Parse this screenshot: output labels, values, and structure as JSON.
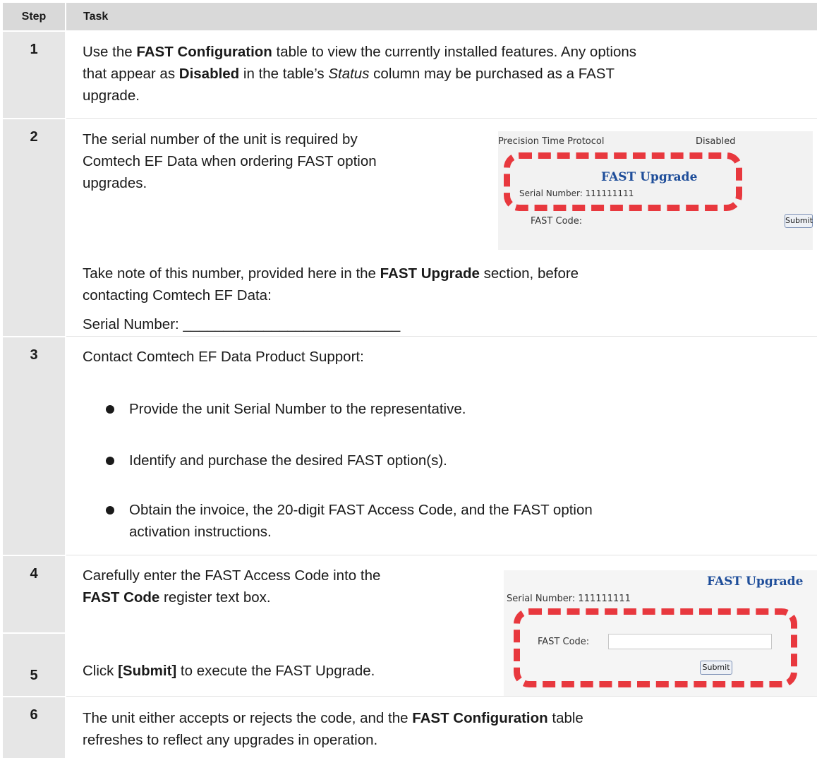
{
  "header": {
    "step": "Step",
    "task": "Task"
  },
  "rows": {
    "r1": {
      "step": "1",
      "line1_pre": "Use the ",
      "line1_bold": "FAST Configuration",
      "line1_post": " table to view the currently installed features. Any options",
      "line2_pre": "that appear as ",
      "line2_bold": "Disabled",
      "line2_mid": " in the table’s ",
      "line2_ital": "Status",
      "line2_post": " column may be purchased as a FAST",
      "line3": "upgrade."
    },
    "r2": {
      "step": "2",
      "line1": "The serial number of the unit is required by",
      "line2": "Comtech EF Data when ordering FAST option",
      "line3": "upgrades.",
      "note1_pre": "Take note of this number, provided here in the ",
      "note1_bold": "FAST Upgrade",
      "note1_post": " section, before",
      "note2": "contacting Comtech EF Data:",
      "serial_line": "Serial Number: ___________________________"
    },
    "r3": {
      "step": "3",
      "intro": "Contact Comtech EF Data Product Support:",
      "bullets": [
        "Provide the unit Serial Number to the representative.",
        "Identify and purchase the desired FAST option(s).",
        "Obtain the invoice, the 20-digit FAST Access Code, and the FAST option"
      ],
      "bullet3_cont": "activation instructions."
    },
    "r4": {
      "step": "4",
      "line1": "Carefully enter the FAST Access Code into the",
      "line2_bold": "FAST Code",
      "line2_post": " register text box."
    },
    "r5": {
      "step": "5",
      "pre": "Click ",
      "bold": "[Submit]",
      "post": " to execute the FAST Upgrade."
    },
    "r6": {
      "step": "6",
      "line1_pre": "The unit either accepts or rejects the code, and the ",
      "line1_bold": "FAST Configuration",
      "line1_post": " table",
      "line2": "refreshes to reflect any upgrades in operation."
    }
  },
  "snippet1": {
    "ptp_label": "Precision Time Protocol",
    "ptp_status": "Disabled",
    "title": "FAST Upgrade",
    "serial": "Serial Number: 111111111",
    "code_label": "FAST Code:",
    "submit": "Submit"
  },
  "snippet2": {
    "title": "FAST Upgrade",
    "serial": "Serial Number: 111111111",
    "code_label": "FAST Code:",
    "submit": "Submit"
  },
  "colors": {
    "highlight_dash": "#e8383e",
    "title_blue": "#1f4e9a",
    "step_bg": "#e6e6e6",
    "header_bg": "#d9d9d9"
  }
}
